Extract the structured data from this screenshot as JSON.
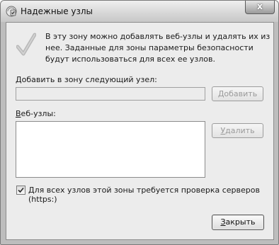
{
  "window": {
    "title": "Надежные узлы",
    "close_glyph": "x"
  },
  "info": {
    "text": "В эту зону можно добавлять веб-узлы и удалять их из нее. Заданные для зоны параметры безопасности будут использоваться для всех ее узлов."
  },
  "add_site": {
    "label_prefix": "",
    "label_accel": "Д",
    "label_rest": "обавить в зону следующий узел:",
    "input_value": "",
    "button_accel": "Д",
    "button_rest": "обавить"
  },
  "sites": {
    "label_accel": "В",
    "label_rest": "еб-узлы:",
    "items": [],
    "remove_accel": "У",
    "remove_rest": "далить"
  },
  "https_check": {
    "checked": true,
    "label_accel": "Д",
    "label_rest": "ля всех узлов этой зоны требуется проверка серверов (https:)"
  },
  "footer": {
    "close_accel": "З",
    "close_rest": "акрыть"
  },
  "icons": {
    "title": "security-zone-icon",
    "info": "checkmark-icon",
    "close": "close-icon"
  }
}
